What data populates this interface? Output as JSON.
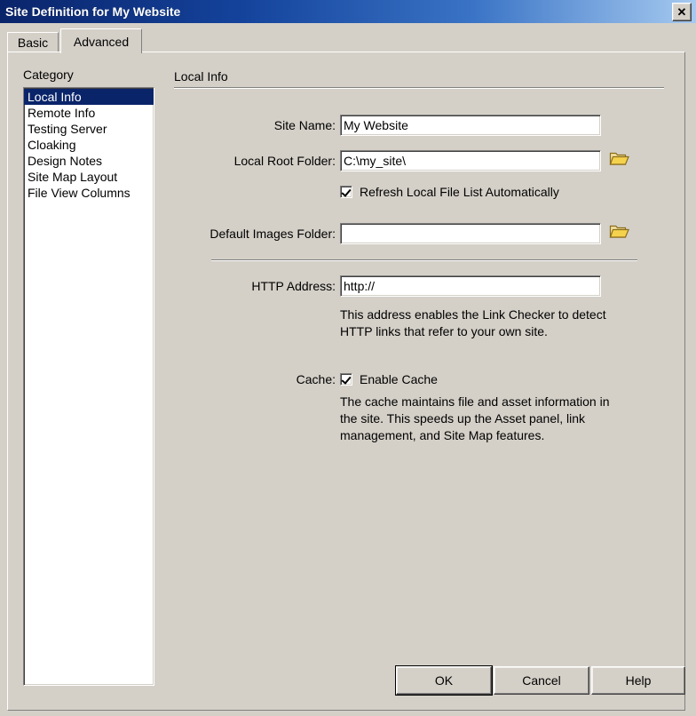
{
  "window": {
    "title": "Site Definition for My Website",
    "close_label": "✕"
  },
  "tabs": [
    {
      "label": "Basic",
      "active": false
    },
    {
      "label": "Advanced",
      "active": true
    }
  ],
  "sidebar": {
    "label": "Category",
    "items": [
      {
        "label": "Local Info",
        "selected": true
      },
      {
        "label": "Remote Info",
        "selected": false
      },
      {
        "label": "Testing Server",
        "selected": false
      },
      {
        "label": "Cloaking",
        "selected": false
      },
      {
        "label": "Design Notes",
        "selected": false
      },
      {
        "label": "Site Map Layout",
        "selected": false
      },
      {
        "label": "File View Columns",
        "selected": false
      }
    ]
  },
  "main": {
    "section_title": "Local Info",
    "site_name": {
      "label": "Site Name:",
      "value": "My Website",
      "placeholder": ""
    },
    "local_root_folder": {
      "label": "Local Root Folder:",
      "value": "C:\\my_site\\",
      "placeholder": "",
      "browse_icon": "folder-icon"
    },
    "refresh_checkbox": {
      "label": "Refresh Local File List Automatically",
      "checked": true
    },
    "default_images_folder": {
      "label": "Default Images Folder:",
      "value": "",
      "placeholder": "",
      "browse_icon": "folder-icon"
    },
    "http_address": {
      "label": "HTTP Address:",
      "value": "http://",
      "placeholder": "",
      "help": "This address enables the Link Checker to detect HTTP links that refer to your own site."
    },
    "cache": {
      "label": "Cache:",
      "checkbox_label": "Enable Cache",
      "checked": true,
      "help": "The cache maintains file and asset information in the site.  This speeds up the Asset panel, link management, and Site Map features."
    }
  },
  "footer": {
    "ok_label": "OK",
    "cancel_label": "Cancel",
    "help_label": "Help"
  },
  "colors": {
    "dialog_face": "#d4d0c8",
    "title_start": "#0a246a",
    "title_end": "#a6caf0",
    "selection": "#0a246a",
    "selection_text": "#ffffff",
    "folder_icon": "#e8c44a"
  }
}
